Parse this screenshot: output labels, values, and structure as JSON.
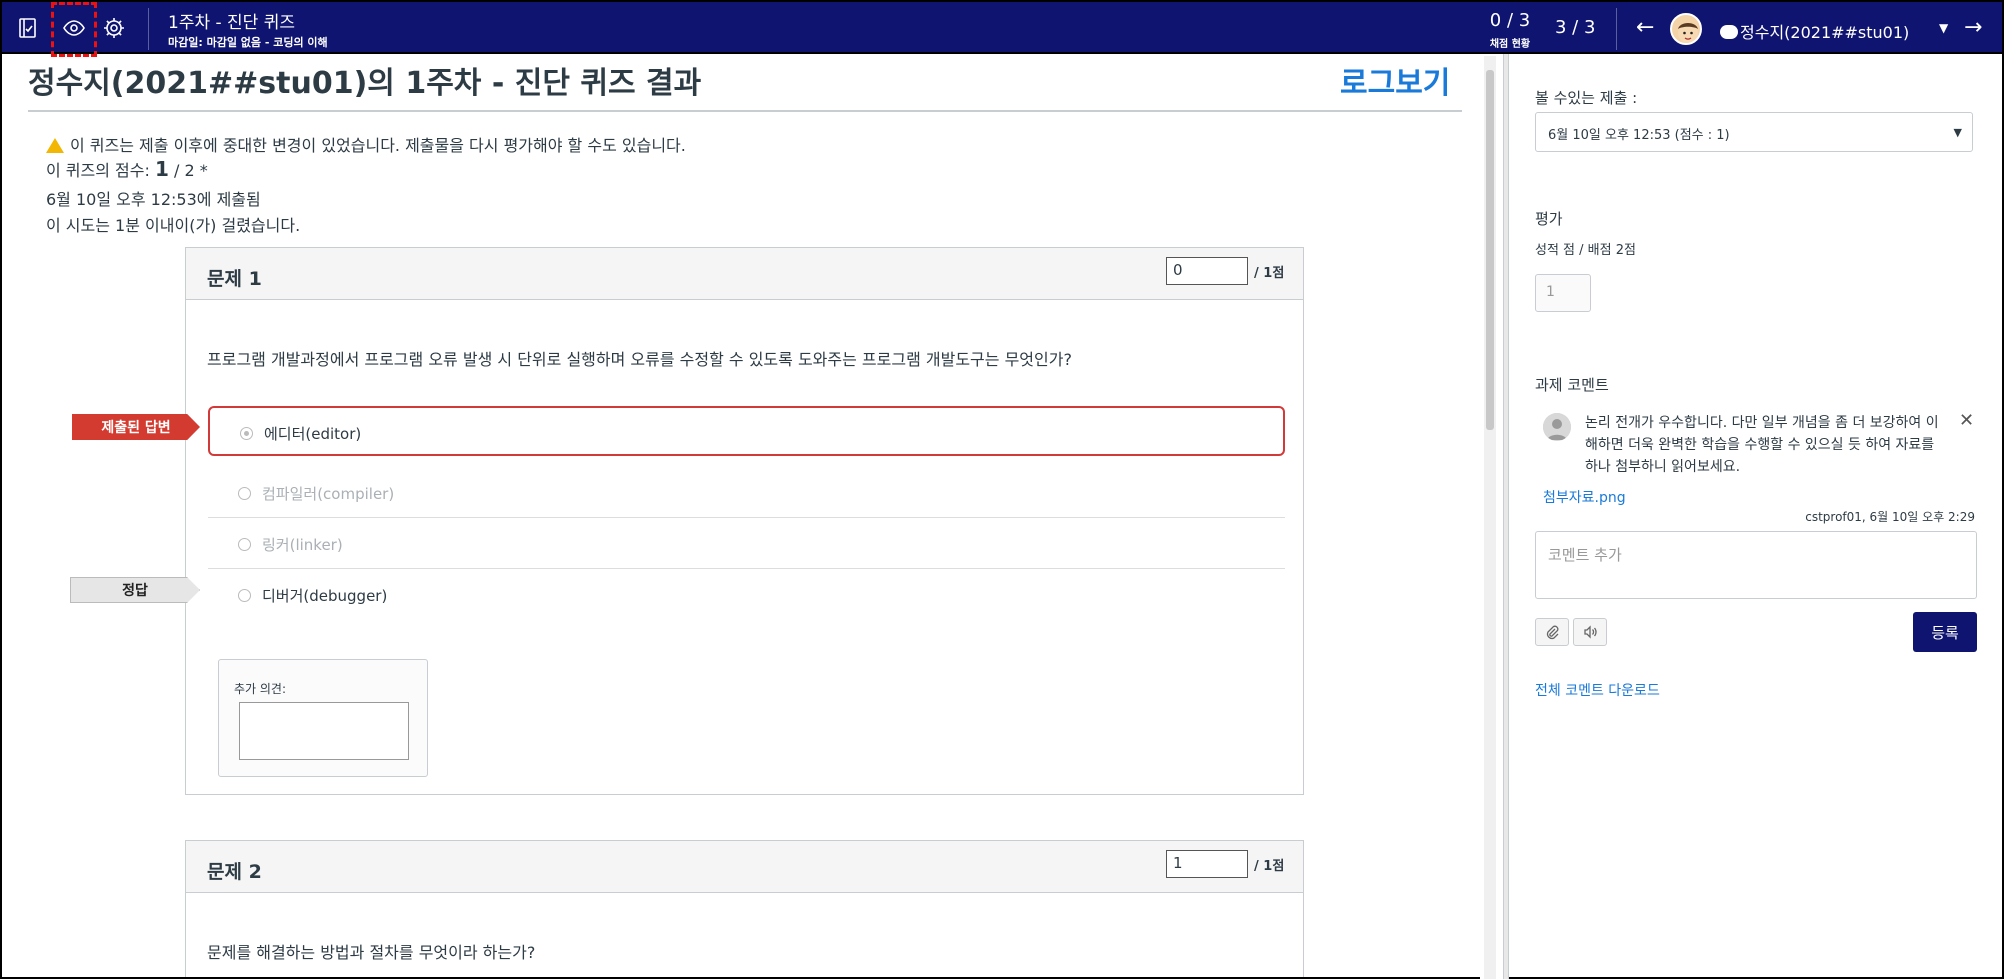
{
  "topbar": {
    "course_title": "1주차 - 진단 퀴즈",
    "due_info": "마감일: 마감일 없음 - 코딩의 이해",
    "graded_count": "0 / 3",
    "graded_label": "채점 현황",
    "position": "3 / 3",
    "user_name": "정수지(2021##stu01)"
  },
  "main": {
    "title": "정수지(2021##stu01)의 1주차 - 진단 퀴즈 결과",
    "log_link": "로그보기",
    "warning": "이 퀴즈는 제출 이후에 중대한 변경이 있었습니다. 제출물을 다시 평가해야 할 수도 있습니다.",
    "score_prefix": "이 퀴즈의 점수:",
    "score_value": "1",
    "score_suffix": "/ 2 *",
    "submitted_at": "6월 10일 오후 12:53에 제출됨",
    "duration": "이 시도는 1분 이내이(가) 걸렸습니다."
  },
  "questions": [
    {
      "name": "문제 1",
      "score": "0",
      "points": "/ 1점",
      "text": "프로그램 개발과정에서 프로그램 오류 발생 시 단위로 실행하며 오류를 수정할 수 있도록 도와주는 프로그램 개발도구는 무엇인가?",
      "answers": [
        "에디터(editor)",
        "컴파일러(compiler)",
        "링커(linker)",
        "디버거(debugger)"
      ],
      "submitted_flag": "제출된 답변",
      "correct_flag": "정답",
      "comment_label": "추가 의견:"
    },
    {
      "name": "문제 2",
      "score": "1",
      "points": "/ 1점",
      "text": "문제를 해결하는 방법과 절차를 무엇이라 하는가?"
    }
  ],
  "sidebar": {
    "submissions_label": "볼 수있는 제출 :",
    "submission_selected": "6월 10일 오후 12:53 (점수 : 1)",
    "grade_label": "평가",
    "grade_sub": "성적 점 / 배점 2점",
    "grade_value": "1",
    "comments_label": "과제 코멘트",
    "comment_text": "논리 전개가 우수합니다. 다만 일부 개념을 좀 더 보강하여 이해하면 더욱 완벽한 학습을 수행할 수 있으실 듯 하여 자료를 하나 첨부하니 읽어보세요.",
    "attachment": "첨부자료.png",
    "comment_meta": "cstprof01, 6월 10일 오후 2:29",
    "comment_placeholder": "코멘트 추가",
    "submit_label": "등록",
    "download_link": "전체 코멘트 다운로드"
  },
  "colors": {
    "topbar": "#0f1470",
    "link": "#1a7ad9",
    "submitted_flag": "#d33a30",
    "selected_border": "#d23a3a"
  }
}
